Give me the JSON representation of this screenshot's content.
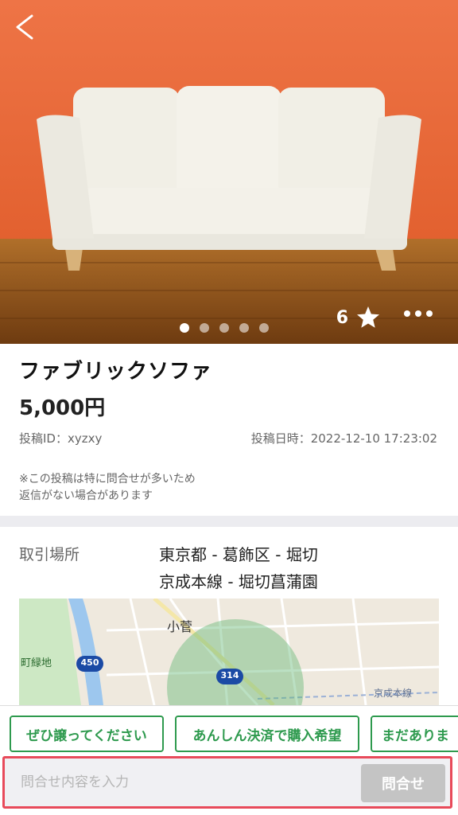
{
  "listing": {
    "title": "ファブリックソファ",
    "price": "5,000円",
    "post_id": "投稿ID：xyzxy",
    "post_date": "投稿日時：2022-12-10 17:23:02",
    "notice_line1": "※この投稿は特に問合せが多いため",
    "notice_line2": "返信がない場合があります",
    "favorite_count": "6"
  },
  "gallery": {
    "image_count": 5,
    "current_index": 0
  },
  "location": {
    "label": "取引場所",
    "line1": "東京都 - 葛飾区 - 堀切",
    "line2": "京成本線 - 堀切菖蒲園"
  },
  "map": {
    "place_label": "小菅",
    "green_label": "町緑地",
    "route1": "450",
    "route2": "314",
    "rail_label": "京成本線"
  },
  "quick_replies": [
    "ぜひ譲ってください",
    "あんしん決済で購入希望",
    "まだありま"
  ],
  "inquiry": {
    "placeholder": "問合せ内容を入力",
    "submit_label": "問合せ"
  },
  "colors": {
    "accent_green": "#2e9a4e",
    "highlight_red": "#e84a5a",
    "wall_orange": "#ea6b3a"
  },
  "icons": {
    "back": "chevron-left-icon",
    "favorite": "star-icon",
    "more": "more-dots-icon"
  }
}
